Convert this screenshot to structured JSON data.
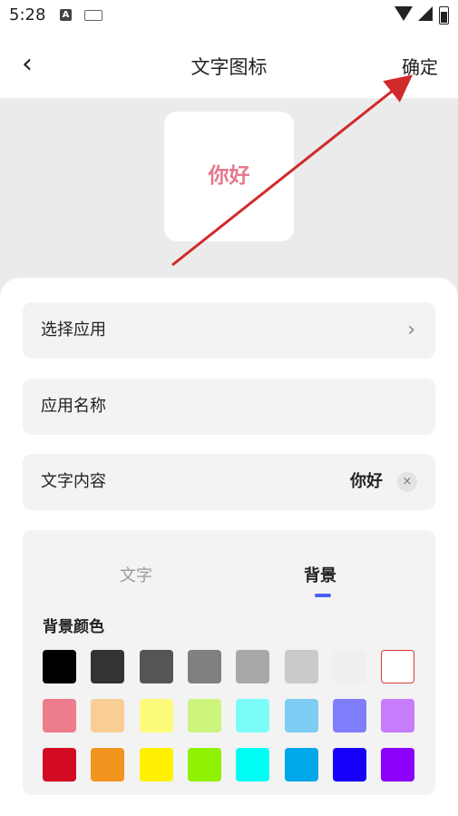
{
  "status_bar": {
    "time": "5:28",
    "a_icon": "A"
  },
  "header": {
    "back_icon": "‹",
    "title": "文字图标",
    "confirm_label": "确定"
  },
  "preview": {
    "text": "你好",
    "text_color": "#e5788a"
  },
  "rows": [
    {
      "label": "选择应用",
      "chevron": "›"
    },
    {
      "label": "应用名称"
    },
    {
      "label": "文字内容",
      "value": "你好",
      "clear_icon": "×"
    }
  ],
  "color_panel": {
    "tabs": [
      "文字",
      "背景"
    ],
    "active_tab": "背景",
    "section_title": "背景颜色",
    "colors": [
      [
        "#000000",
        "#333333",
        "#555555",
        "#808080",
        "#a8a8a8",
        "#cacaca",
        "#efefef",
        "#ffffff"
      ],
      [
        "#ed7d8c",
        "#f8ce94",
        "#fdfb7b",
        "#cdf47d",
        "#7bfdfa",
        "#7ecdf5",
        "#7f7dfb",
        "#c77dfb"
      ],
      [
        "#d20b22",
        "#f3941f",
        "#fff101",
        "#90f200",
        "#00fef5",
        "#00a7e9",
        "#1700f9",
        "#8c00fb"
      ]
    ],
    "selected_color": "#ffffff"
  }
}
